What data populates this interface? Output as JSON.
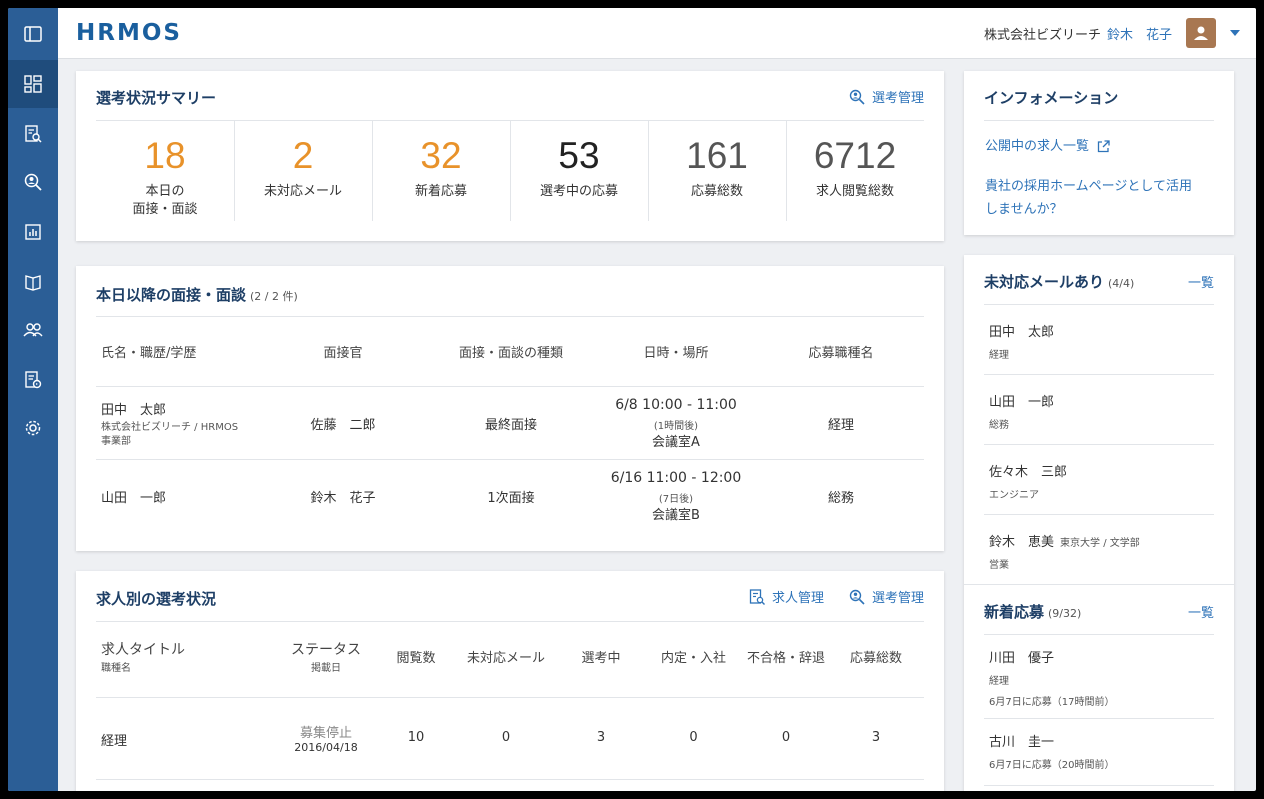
{
  "header": {
    "logo": "HRMOS",
    "company": "株式会社ビズリーチ",
    "user_name": "鈴木　花子"
  },
  "sidebar": {
    "items": [
      "menu-icon",
      "dashboard-icon",
      "document-search-icon",
      "person-search-icon",
      "chart-icon",
      "book-icon",
      "people-icon",
      "clipboard-icon",
      "gear-icon"
    ]
  },
  "summary": {
    "title": "選考状況サマリー",
    "link": "選考管理",
    "stats": [
      {
        "value": "18",
        "label": "本日の\n面接・面談",
        "color": "#e8922a"
      },
      {
        "value": "2",
        "label": "未対応メール",
        "color": "#e8922a"
      },
      {
        "value": "32",
        "label": "新着応募",
        "color": "#e8922a"
      },
      {
        "value": "53",
        "label": "選考中の応募",
        "color": "#222222"
      },
      {
        "value": "161",
        "label": "応募総数",
        "color": "#555555"
      },
      {
        "value": "6712",
        "label": "求人閲覧総数",
        "color": "#555555"
      }
    ]
  },
  "interviews": {
    "title": "本日以降の面接・面談",
    "count": "(2 / 2 件)",
    "columns": [
      "氏名・職歴/学歴",
      "面接官",
      "面接・面談の種類",
      "日時・場所",
      "応募職種名"
    ],
    "rows": [
      {
        "name": "田中　太郎",
        "career": "株式会社ビズリーチ / HRMOS",
        "career2": "事業部",
        "interviewer": "佐藤　二郎",
        "type": "最終面接",
        "datetime": "6/8 10:00 - 11:00",
        "relative": "(1時間後)",
        "place": "会議室A",
        "job": "経理"
      },
      {
        "name": "山田　一郎",
        "career": "",
        "career2": "",
        "interviewer": "鈴木　花子",
        "type": "1次面接",
        "datetime": "6/16 11:00 - 12:00",
        "relative": "(7日後)",
        "place": "会議室B",
        "job": "総務"
      }
    ]
  },
  "jobs": {
    "title": "求人別の選考状況",
    "link_jobs": "求人管理",
    "link_selection": "選考管理",
    "columns": {
      "title": "求人タイトル",
      "title_sub": "職種名",
      "status": "ステータス",
      "status_sub": "掲載日",
      "views": "閲覧数",
      "unanswered": "未対応メール",
      "in_progress": "選考中",
      "offer": "内定・入社",
      "rejected": "不合格・辞退",
      "total": "応募総数"
    },
    "rows": [
      {
        "title": "経理",
        "status": "募集停止",
        "date": "2016/04/18",
        "views": "10",
        "unanswered": "0",
        "in_progress": "3",
        "offer": "0",
        "rejected": "0",
        "total": "3"
      }
    ]
  },
  "information": {
    "title": "インフォメーション",
    "link1": "公開中の求人一覧",
    "link2_line1": "貴社の採用ホームページとして活用",
    "link2_line2": "しませんか？"
  },
  "unanswered_mail": {
    "title": "未対応メールあり",
    "count": "(4/4)",
    "list_link": "一覧",
    "people": [
      {
        "name": "田中　太郎",
        "role": "経理",
        "extra": ""
      },
      {
        "name": "山田　一郎",
        "role": "総務",
        "extra": ""
      },
      {
        "name": "佐々木　三郎",
        "role": "エンジニア",
        "extra": ""
      },
      {
        "name": "鈴木　恵美",
        "role": "営業",
        "extra": "東京大学 / 文学部"
      }
    ]
  },
  "new_applications": {
    "title": "新着応募",
    "count": "(9/32)",
    "list_link": "一覧",
    "people": [
      {
        "name": "川田　優子",
        "role": "経理",
        "applied": "6月7日に応募（17時間前）"
      },
      {
        "name": "古川　圭一",
        "role": "",
        "applied": "6月7日に応募（20時間前）"
      }
    ]
  }
}
